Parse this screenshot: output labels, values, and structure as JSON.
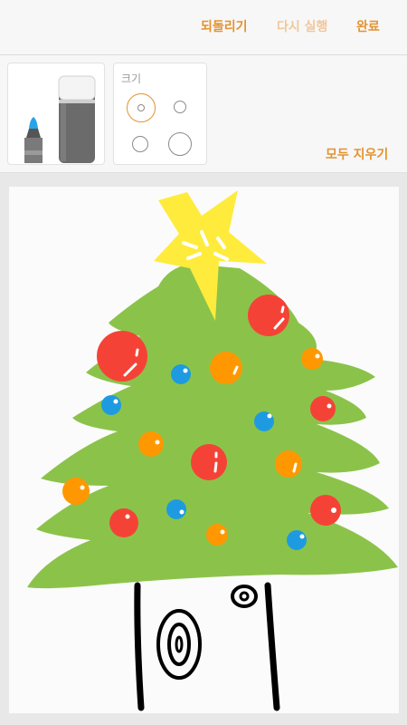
{
  "toolbar": {
    "undo_label": "되돌리기",
    "redo_label": "다시 실행",
    "done_label": "완료"
  },
  "tools": {
    "pen_icon": "marker-pen-icon",
    "eraser_icon": "eraser-icon",
    "pen_color": "#2aa3e6"
  },
  "size_panel": {
    "label": "크기",
    "sizes": [
      "small",
      "tiny",
      "medium",
      "large"
    ],
    "selected_index": 0
  },
  "clear_all_label": "모두 지우기",
  "colors": {
    "accent": "#e39332",
    "accent_disabled": "#f1c79a",
    "tree_green": "#8bc34a",
    "star_yellow": "#ffeb3b",
    "ornament_red": "#f44336",
    "ornament_orange": "#ff9800",
    "ornament_blue": "#1e9be0"
  }
}
